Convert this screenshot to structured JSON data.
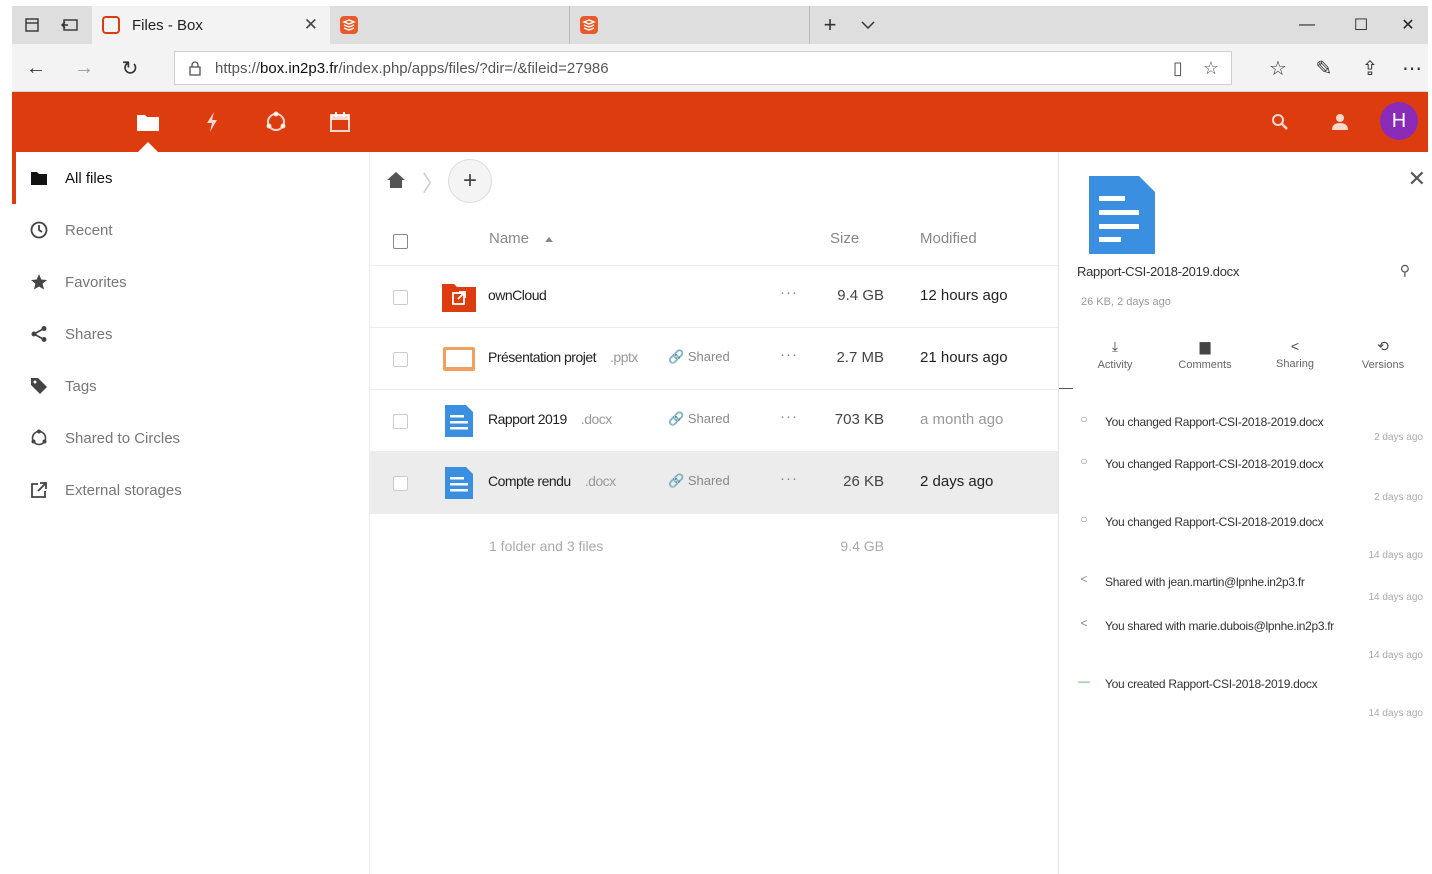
{
  "browser": {
    "tabs": [
      {
        "title": "Files - Box",
        "active": true
      },
      {
        "title": "",
        "active": false
      },
      {
        "title": "",
        "active": false
      }
    ],
    "url_prefix": "https://",
    "url_host": "box.in2p3.fr",
    "url_path": "/index.php/apps/files/?dir=/&fileid=27986"
  },
  "app": {
    "accent": "#dd3c0f",
    "avatar_letter": "H",
    "avatar_color": "#8a2bb8"
  },
  "sidebar": {
    "items": [
      {
        "label": "All files",
        "icon": "folder-icon",
        "active": true
      },
      {
        "label": "Recent",
        "icon": "clock-icon",
        "active": false
      },
      {
        "label": "Favorites",
        "icon": "star-icon",
        "active": false
      },
      {
        "label": "Shares",
        "icon": "share-icon",
        "active": false
      },
      {
        "label": "Tags",
        "icon": "tag-icon",
        "active": false
      },
      {
        "label": "Shared to Circles",
        "icon": "circles-icon",
        "active": false
      },
      {
        "label": "External storages",
        "icon": "external-link-icon",
        "active": false
      }
    ]
  },
  "filelist": {
    "headers": {
      "name": "Name",
      "size": "Size",
      "modified": "Modified"
    },
    "rows": [
      {
        "name": "ownCloud",
        "ext": "",
        "share": "",
        "size": "9.4 GB",
        "modified": "12 hours ago",
        "type": "folder-external"
      },
      {
        "name": "Présentation projet",
        "ext": ".pptx",
        "share": "Shared",
        "size": "2.7 MB",
        "modified": "21 hours ago",
        "type": "presentation"
      },
      {
        "name": "Rapport 2019",
        "ext": ".docx",
        "share": "Shared",
        "size": "703 KB",
        "modified": "a month ago",
        "type": "document"
      },
      {
        "name": "Compte rendu",
        "ext": ".docx",
        "share": "Shared",
        "size": "26 KB",
        "modified": "2 days ago",
        "type": "document"
      }
    ],
    "summary": {
      "count": "1 folder and 3 files",
      "size": "9.4 GB"
    }
  },
  "details": {
    "title": "Rapport-CSI-2018-2019.docx",
    "meta": "26 KB, 2 days ago",
    "tabs": [
      "Activity",
      "Comments",
      "Sharing",
      "Versions"
    ],
    "activities": [
      {
        "text": "You changed Rapport-CSI-2018-2019.docx",
        "when": "2 days ago"
      },
      {
        "text": "You changed Rapport-CSI-2018-2019.docx",
        "when": "2 days ago"
      },
      {
        "text": "You changed Rapport-CSI-2018-2019.docx",
        "when": "14 days ago"
      },
      {
        "text": "Shared with jean.martin@lpnhe.in2p3.fr",
        "when": "14 days ago"
      },
      {
        "text": "You shared with marie.dubois@lpnhe.in2p3.fr",
        "when": "14 days ago"
      },
      {
        "text": "You created Rapport-CSI-2018-2019.docx",
        "when": "14 days ago"
      }
    ]
  }
}
